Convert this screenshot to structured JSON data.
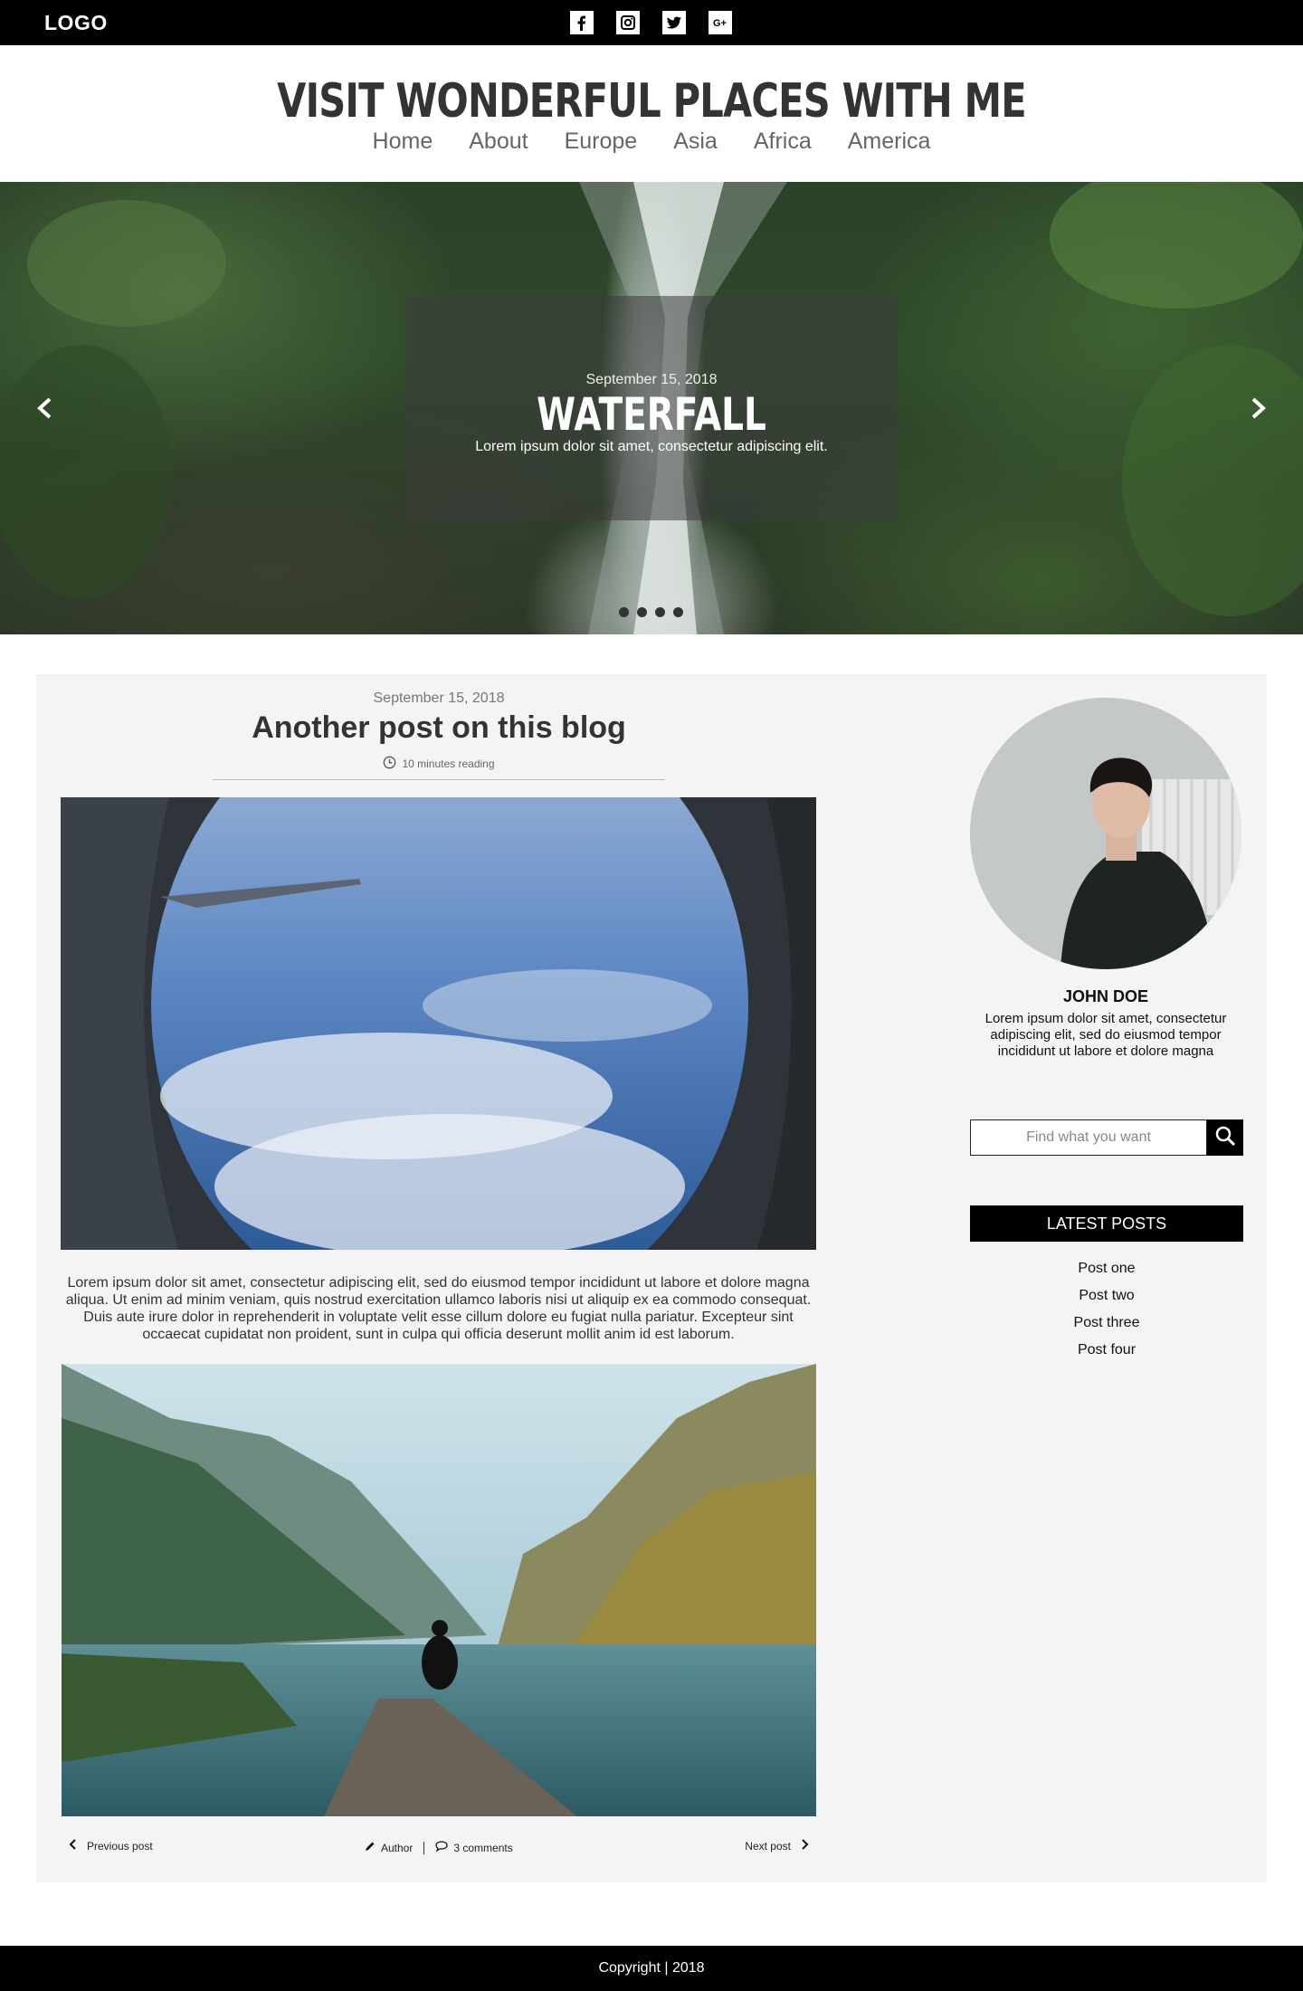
{
  "topbar": {
    "logo": "LOGO",
    "socials": [
      "facebook-icon",
      "instagram-icon",
      "twitter-icon",
      "google-plus-icon"
    ]
  },
  "header": {
    "title": "VISIT WONDERFUL PLACES WITH ME",
    "nav": [
      "Home",
      "About",
      "Europe",
      "Asia",
      "Africa",
      "America"
    ]
  },
  "hero": {
    "date": "September 15, 2018",
    "title": "WATERFALL",
    "text": "Lorem ipsum dolor sit amet, consectetur adipiscing elit.",
    "slide_count": 4
  },
  "post": {
    "date": "September 15, 2018",
    "title": "Another post on this blog",
    "reading_time": "10 minutes reading",
    "body": "Lorem ipsum dolor sit amet, consectetur adipiscing elit, sed do eiusmod tempor incididunt ut labore et dolore magna aliqua. Ut enim ad minim veniam, quis nostrud exercitation ullamco laboris nisi ut aliquip ex ea commodo consequat. Duis aute irure dolor in reprehenderit in voluptate velit esse cillum dolore eu fugiat nulla pariatur. Excepteur sint occaecat cupidatat non proident, sunt in culpa qui officia deserunt mollit anim id est laborum.",
    "prev_label": "Previous post",
    "next_label": "Next post",
    "author_label": "Author",
    "comments_label": "3 comments"
  },
  "sidebar": {
    "author_name": "JOHN DOE",
    "author_bio": "Lorem ipsum dolor sit amet, consectetur adipiscing elit, sed do eiusmod tempor incididunt ut labore et dolore magna",
    "search_placeholder": "Find what you want",
    "latest_heading": "LATEST POSTS",
    "latest_posts": [
      "Post one",
      "Post two",
      "Post three",
      "Post four"
    ]
  },
  "footer": {
    "copyright": "Copyright | 2018"
  },
  "colors": {
    "bar": "#000000",
    "content_bg": "#f4f4f4",
    "title_text": "#333333"
  }
}
